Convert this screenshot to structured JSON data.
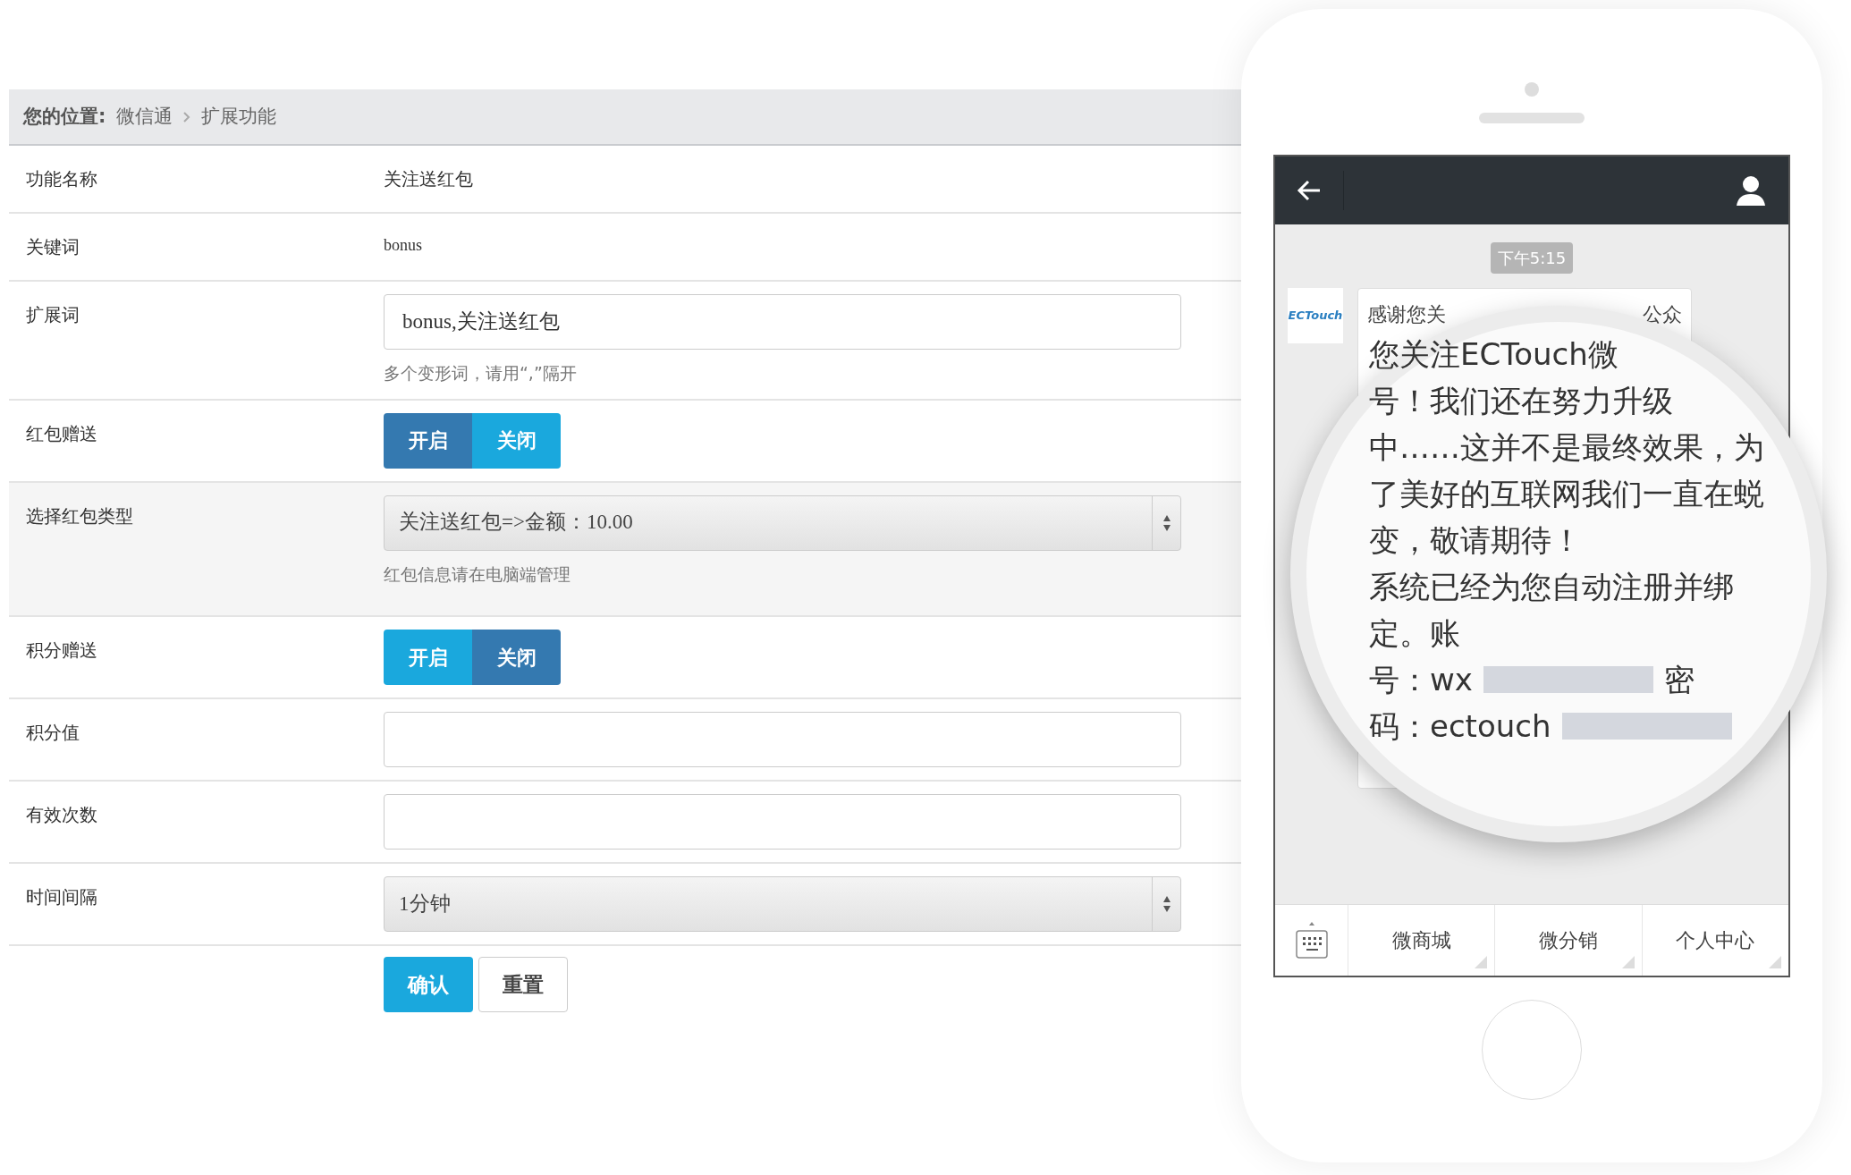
{
  "breadcrumb": {
    "label": "您的位置:",
    "items": [
      "微信通",
      "扩展功能"
    ]
  },
  "form": [
    {
      "kind": "text",
      "label": "功能名称",
      "value": "关注送红包"
    },
    {
      "kind": "small_text",
      "label": "关键词",
      "value": "bonus"
    },
    {
      "kind": "input",
      "label": "扩展词",
      "value": "bonus,关注送红包",
      "help": "多个变形词，请用“,”隔开"
    },
    {
      "kind": "toggle",
      "label": "红包赠送",
      "options": [
        {
          "label": "开启",
          "selected": true
        },
        {
          "label": "关闭",
          "selected": false
        }
      ]
    },
    {
      "kind": "select",
      "label": "选择红包类型",
      "value": "关注送红包=>金额：10.00",
      "help": "红包信息请在电脑端管理",
      "shaded": true
    },
    {
      "kind": "toggle",
      "label": "积分赠送",
      "options": [
        {
          "label": "开启",
          "selected": false
        },
        {
          "label": "关闭",
          "selected": true
        }
      ]
    },
    {
      "kind": "input",
      "label": "积分值"
    },
    {
      "kind": "input",
      "label": "有效次数"
    },
    {
      "kind": "select",
      "label": "时间间隔",
      "value": "1分钟"
    }
  ],
  "actions": [
    {
      "kind": "primary",
      "label": "确认"
    },
    {
      "kind": "default",
      "label": "重置"
    }
  ],
  "phone": {
    "time": "下午5:15",
    "avatar_text": "ECTouch",
    "bubble_fragments": [
      "感谢您关",
      "公众"
    ],
    "lens_lines": [
      {
        "text": "您关注ECTouch微"
      },
      {
        "text": "号！我们还在努力升级"
      },
      {
        "text": "中……这并不是最终效果，为"
      },
      {
        "text": "了美好的互联网我们一直在蜕"
      },
      {
        "text": "变，敬请期待！"
      },
      {
        "text": "系统已经为您自动注册并绑"
      },
      {
        "text": "定。账"
      },
      {
        "text": "号：wx",
        "blurred": true,
        "after": "密"
      },
      {
        "text": "码：ectouch",
        "blurred": true
      }
    ],
    "menu": [
      "微商城",
      "微分销",
      "个人中心"
    ]
  }
}
